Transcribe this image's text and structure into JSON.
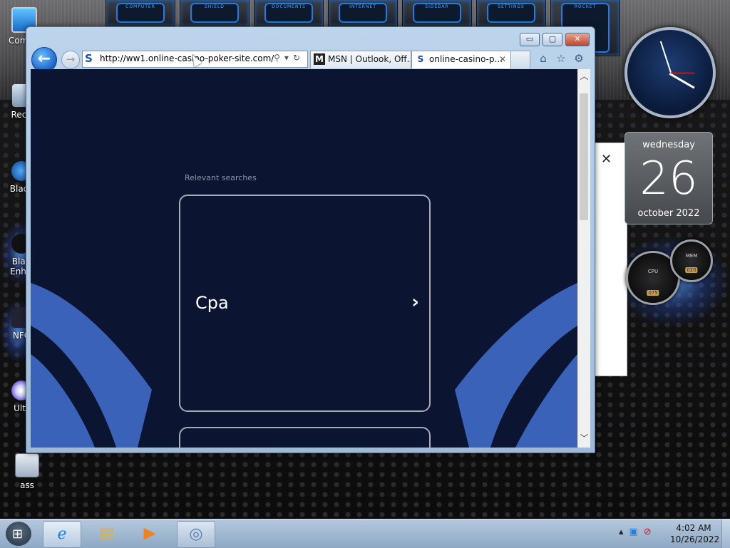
{
  "desktop": {
    "icons": [
      {
        "label": "Com",
        "icon": "computer-icon"
      },
      {
        "label": "Recy",
        "icon": "recycle-bin-icon"
      },
      {
        "label": "Black",
        "icon": "browser-icon"
      },
      {
        "label": "Black Enhan",
        "icon": "app-icon"
      },
      {
        "label": "NFC",
        "icon": "app-icon"
      },
      {
        "label": "Ultr",
        "icon": "disc-icon"
      },
      {
        "label": "ass",
        "icon": "file-icon"
      }
    ],
    "dock_tiles": [
      "COMPUTER",
      "SHIELD",
      "DOCUMENTS",
      "INTERNET",
      "SIDEBAR",
      "SETTINGS",
      "ROCKET"
    ]
  },
  "browser": {
    "window_buttons": {
      "minimize": "▭",
      "maximize": "▢",
      "close": "✕"
    },
    "address": {
      "url": "http://ww1.online-casino-poker-site.com/"
    },
    "tabs": [
      {
        "label": "MSN | Outlook, Off...",
        "icon": "msn-icon"
      },
      {
        "label": "online-casino-p...",
        "icon": "site-icon",
        "active": true
      }
    ],
    "tab_close": "✕",
    "page": {
      "relevant_label": "Relevant searches",
      "cards": [
        {
          "label": "Cpa"
        }
      ]
    }
  },
  "side_panel": {
    "close": "✕"
  },
  "gadgets": {
    "calendar": {
      "day": "wednesday",
      "date": "26",
      "month": "october 2022"
    },
    "gauges": {
      "cpu_label": "CPU",
      "cpu_value": "075",
      "mem_label": "MEM",
      "mem_value": "020"
    }
  },
  "taskbar": {
    "time": "4:02 AM",
    "date": "10/26/2022"
  },
  "colors": {
    "page_bg": "#0b1430",
    "wave_blue": "#3a62b8",
    "card_border": "#a6abb6"
  }
}
